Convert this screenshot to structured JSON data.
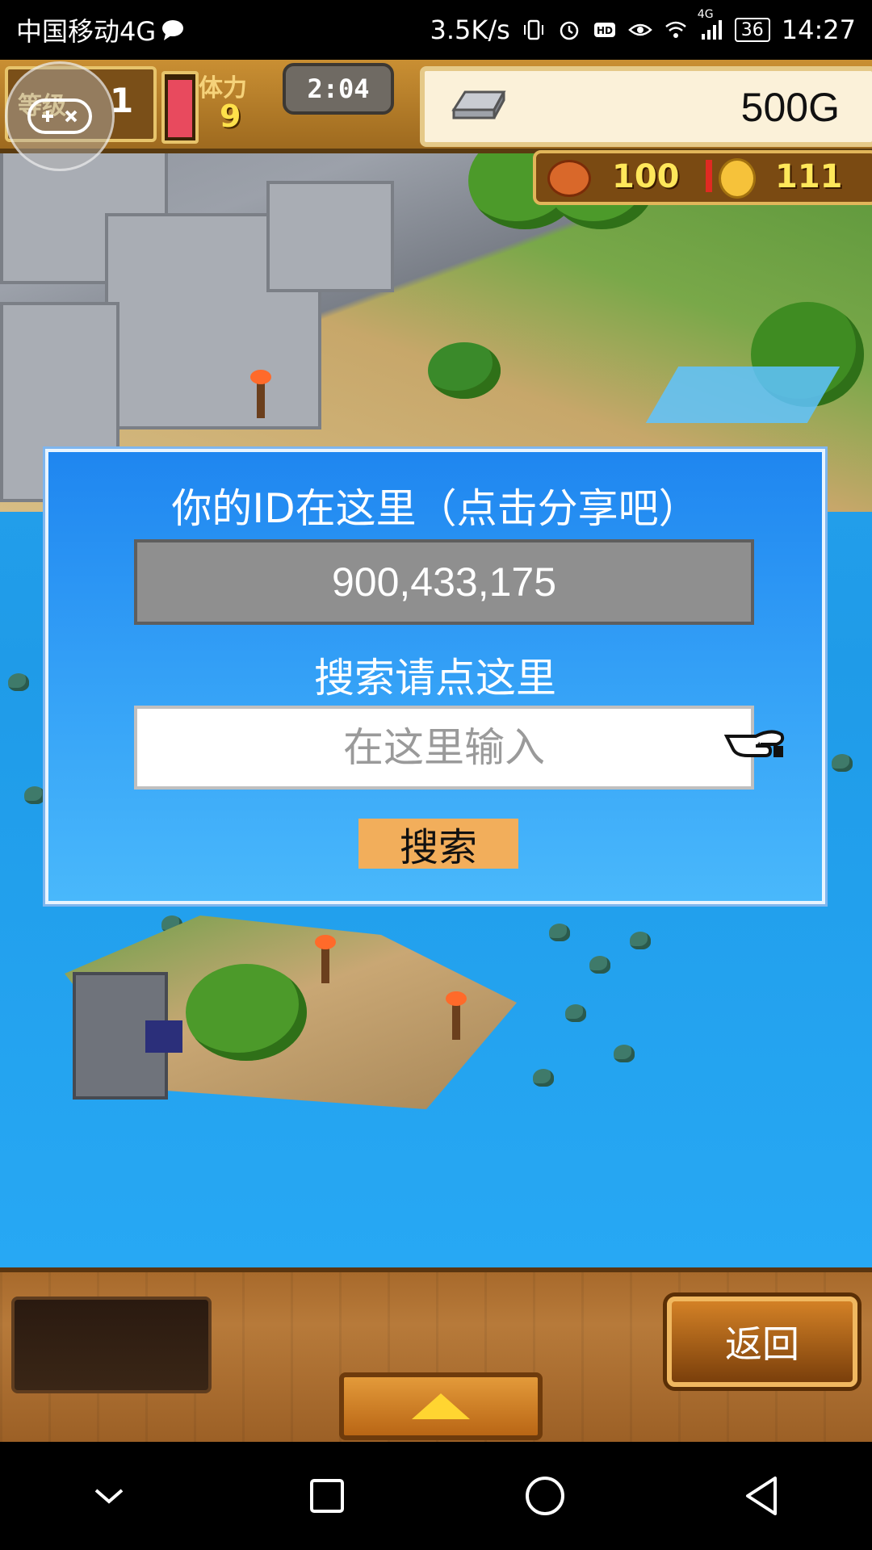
{
  "statusbar": {
    "carrier": "中国移动4G",
    "speed": "3.5K/s",
    "network": "4G",
    "battery": "36",
    "time": "14:27",
    "icons": [
      "chat-bubble-icon",
      "vibrate-icon",
      "alarm-icon",
      "hd-icon",
      "eye-icon",
      "wifi-icon",
      "signal-icon"
    ]
  },
  "hud": {
    "level_label": "等级",
    "level_value": "1",
    "stamina_label": "体力",
    "stamina_value": "9",
    "stamina_fill": 0.86,
    "timer": "2:04",
    "gold": "500G",
    "meat": "100",
    "coins": "111"
  },
  "dialog": {
    "title": "你的ID在这里（点击分享吧）",
    "id_value": "900,433,175",
    "search_hint": "搜索请点这里",
    "search_placeholder": "在这里输入",
    "search_button": "搜索"
  },
  "bottom": {
    "back_label": "返回"
  },
  "navbar": {
    "icons": [
      "chevron-down-icon",
      "square-recent-icon",
      "circle-home-icon",
      "triangle-back-icon"
    ]
  },
  "colors": {
    "dialog_top": "#1f86f0",
    "dialog_bottom": "#49b8fb",
    "search_button": "#f2ae5b",
    "id_field": "#8f8f8f",
    "water": "#1f9be8"
  }
}
